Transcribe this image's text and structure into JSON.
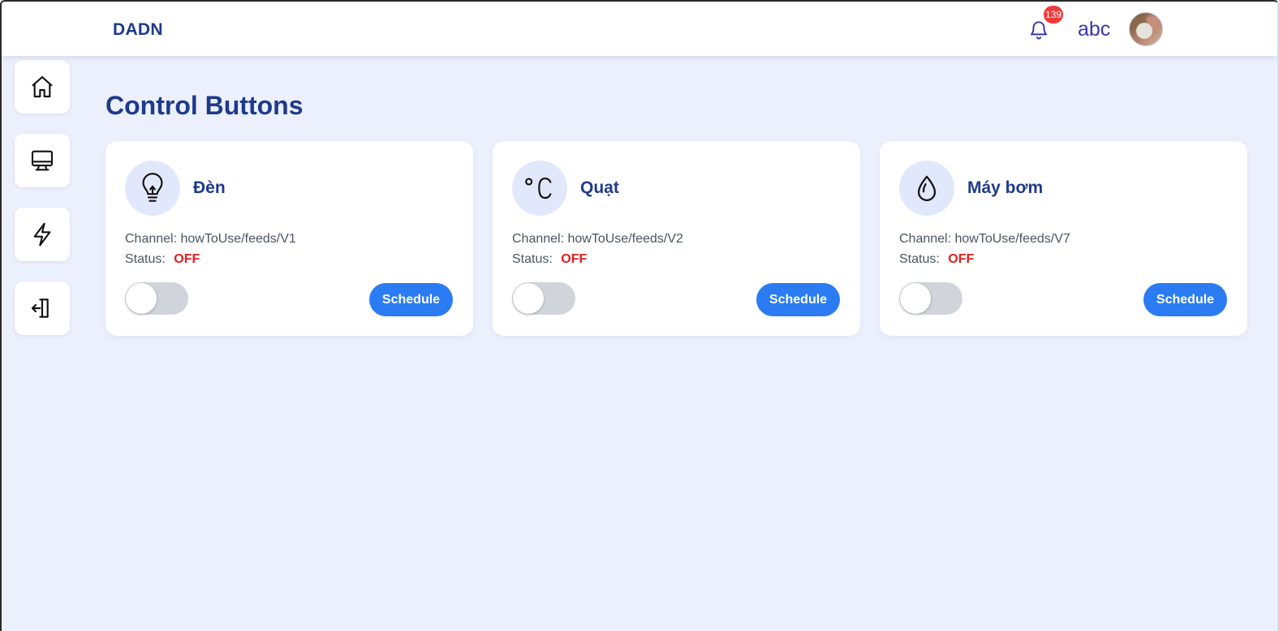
{
  "app": {
    "brand": "DADN"
  },
  "header": {
    "notification_count": "139",
    "username": "abc"
  },
  "sidebar": {
    "items": [
      {
        "icon": "home-icon"
      },
      {
        "icon": "monitor-icon"
      },
      {
        "icon": "lightning-icon"
      },
      {
        "icon": "logout-icon"
      }
    ]
  },
  "page": {
    "title": "Control Buttons"
  },
  "devices": [
    {
      "name": "Đèn",
      "icon": "lightbulb-icon",
      "channel_label": "Channel:",
      "channel": "howToUse/feeds/V1",
      "status_label": "Status:",
      "status": "OFF",
      "toggle_on": false,
      "schedule_label": "Schedule"
    },
    {
      "name": "Quạt",
      "icon": "celsius-icon",
      "channel_label": "Channel:",
      "channel": "howToUse/feeds/V2",
      "status_label": "Status:",
      "status": "OFF",
      "toggle_on": false,
      "schedule_label": "Schedule"
    },
    {
      "name": "Máy bơm",
      "icon": "water-drop-icon",
      "channel_label": "Channel:",
      "channel": "howToUse/feeds/V7",
      "status_label": "Status:",
      "status": "OFF",
      "toggle_on": false,
      "schedule_label": "Schedule"
    }
  ],
  "colors": {
    "background": "#ecf0fd",
    "brand": "#1e3a8a",
    "accent": "#2b7bf3",
    "status_off": "#e11d1d",
    "badge": "#ef3b3b"
  }
}
